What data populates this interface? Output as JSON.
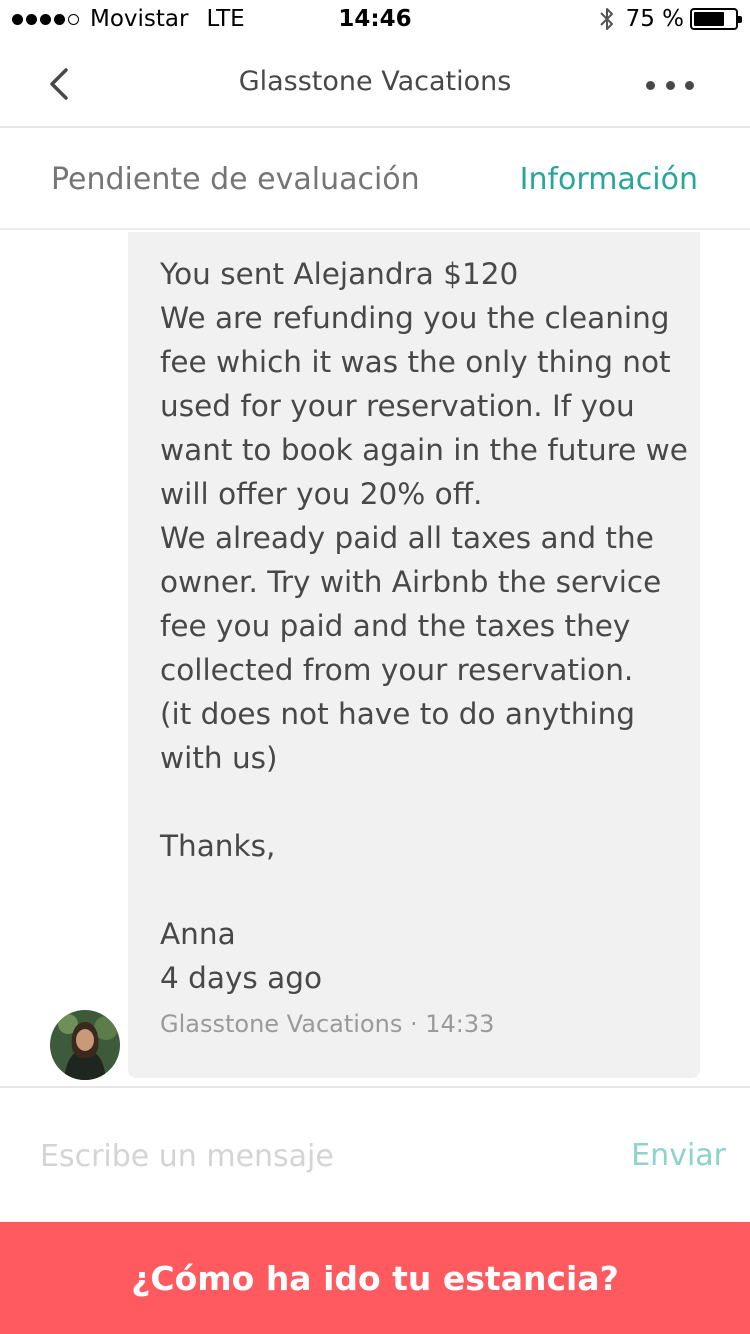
{
  "status_bar": {
    "carrier": "Movistar",
    "network": "LTE",
    "time": "14:46",
    "battery": "75 %",
    "battery_level": 0.75
  },
  "nav": {
    "title": "Glasstone Vacations",
    "back_icon": "chevron-left-icon",
    "more_icon": "more-horizontal-icon"
  },
  "sub_header": {
    "status": "Pendiente de evaluación",
    "info_link": "Información"
  },
  "message": {
    "text": "You sent Alejandra $120\nWe are refunding you the cleaning fee which it was the only thing not used for your reservation. If you want to book again in the future we will offer you 20% off.\nWe already paid all taxes and the owner. Try with Airbnb the service fee you paid and the taxes they collected from your reservation.\n(it does not have to do anything with us)\n\nThanks,\n\nAnna\n4 days ago",
    "meta": "Glasstone Vacations · 14:33"
  },
  "composer": {
    "placeholder": "Escribe un mensaje",
    "send_label": "Enviar"
  },
  "cta": {
    "label": "¿Cómo ha ido tu estancia?"
  },
  "colors": {
    "accent_teal": "#27a799",
    "send_teal_disabled": "#8cd3ca",
    "cta_red": "#ff5a5f",
    "bubble_bg": "#f1f1f1"
  }
}
